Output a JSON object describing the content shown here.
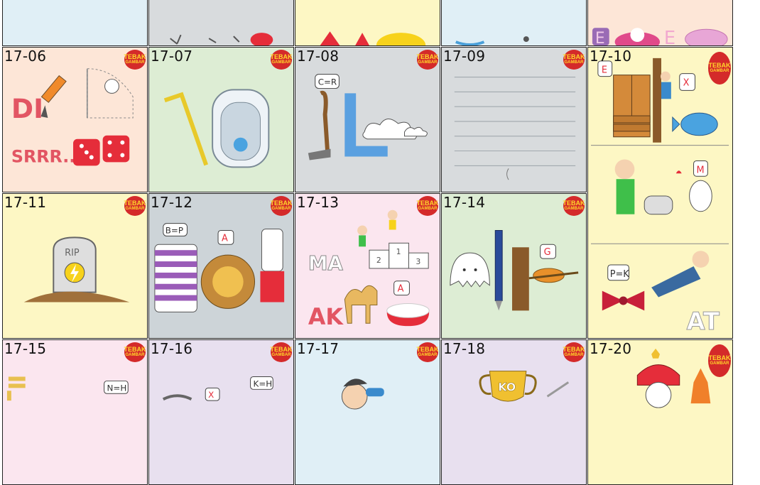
{
  "brand": {
    "badge_line1": "TEBAK",
    "badge_line2": "GAMBAR"
  },
  "colors": {
    "pink": "#fbe6ef",
    "grey": "#d8dbdd",
    "yellow": "#fdf7c4",
    "blue": "#e0eff6",
    "peach": "#fde6d7",
    "green": "#ddedd4",
    "lilac": "#e8e0ef",
    "slate": "#cdd4d8",
    "red": "#e52d3a"
  },
  "tiles": [
    {
      "id": "17-06"
    },
    {
      "id": "17-07"
    },
    {
      "id": "17-08"
    },
    {
      "id": "17-09"
    },
    {
      "id": "17-10"
    },
    {
      "id": "17-11"
    },
    {
      "id": "17-12"
    },
    {
      "id": "17-13"
    },
    {
      "id": "17-14"
    },
    {
      "id": "17-15"
    },
    {
      "id": "17-16"
    },
    {
      "id": "17-17"
    },
    {
      "id": "17-18"
    },
    {
      "id": "17-20"
    }
  ],
  "hints": {
    "t0606_word1": "DI",
    "t0606_word2": "SRRR..",
    "t0608_bubble": "C=R",
    "t0610_bubble1": "E",
    "t0610_bubble2": "X",
    "t0610_bubble3": "M",
    "t0610_bubble4": "P=K",
    "t0610_word": "AT",
    "t0611_rip": "RIP",
    "t0612_bubble1": "B=P",
    "t0612_bubble2": "A",
    "t0613_word1": "MA",
    "t0613_word2": "AK",
    "t0613_bubble": "A",
    "t0613_pod1": "1",
    "t0613_pod2": "2",
    "t0613_pod3": "3",
    "t0614_bubble": "G",
    "t0615_bubble": "N=H",
    "t0616_bubble1": "X",
    "t0616_bubble2": "K=H",
    "t0618_cup": "KO",
    "top_e1": "E",
    "top_e2": "E"
  }
}
